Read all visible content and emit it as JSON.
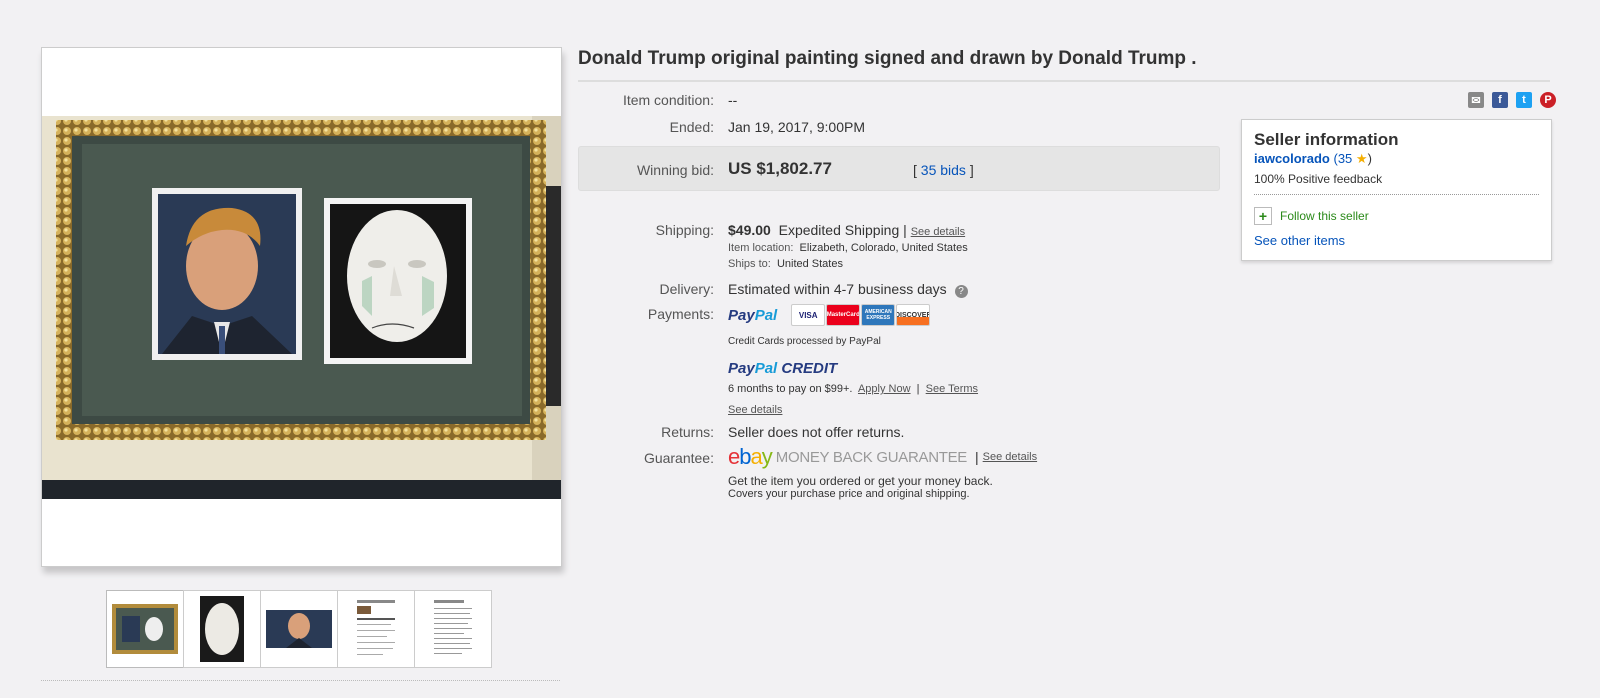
{
  "title": "Donald Trump original painting signed and drawn by Donald Trump .",
  "details": {
    "condition_label": "Item condition:",
    "condition_value": "--",
    "ended_label": "Ended:",
    "ended_value": "Jan 19, 2017, 9:00PM",
    "winning_bid_label": "Winning bid:",
    "winning_bid_value": "US $1,802.77",
    "bids_open": "[",
    "bids_link": "35 bids",
    "bids_close": "]",
    "shipping_label": "Shipping:",
    "shipping_price": "$49.00",
    "shipping_method": "Expedited Shipping",
    "shipping_separator": "|",
    "shipping_see_details": "See details",
    "item_location_label": "Item location:",
    "item_location_value": "Elizabeth, Colorado, United States",
    "ships_to_label": "Ships to:",
    "ships_to_value": "United States",
    "delivery_label": "Delivery:",
    "delivery_value": "Estimated within 4-7 business days",
    "delivery_help_icon": "?",
    "payments_label": "Payments:",
    "paypal_pay": "Pay",
    "paypal_pal": "Pal",
    "cards": [
      {
        "name": "VISA",
        "color": "#1a1f71"
      },
      {
        "name": "MasterCard",
        "color": "#eb001b"
      },
      {
        "name": "AMERICAN EXPRESS",
        "color": "#2e77bb"
      },
      {
        "name": "DISCOVER",
        "color": "#f76f20"
      }
    ],
    "credit_cards_note": "Credit Cards processed by PayPal",
    "paypal_credit_word": "CREDIT",
    "credit_offer": "6 months to pay on $99+.",
    "apply_now": "Apply Now",
    "credit_separator": "|",
    "see_terms": "See Terms",
    "credit_see_details": "See details",
    "returns_label": "Returns:",
    "returns_value": "Seller does not offer returns.",
    "guarantee_label": "Guarantee:",
    "ebay_letters": [
      "e",
      "b",
      "a",
      "y"
    ],
    "ebay_colors": [
      "#e53238",
      "#0064d2",
      "#f5af02",
      "#86b817"
    ],
    "money_back": "MONEY BACK GUARANTEE",
    "guarantee_separator": "|",
    "guarantee_see_details": "See details",
    "guarantee_line1": "Get the item you ordered or get your money back.",
    "guarantee_line2": "Covers your purchase price and original shipping."
  },
  "seller": {
    "heading": "Seller information",
    "username": "iawcolorado",
    "feedback_open": "(",
    "feedback_count": "35",
    "feedback_close": ")",
    "star_icon": "★",
    "positive": "100% Positive feedback",
    "follow_icon": "+",
    "follow_label": "Follow this seller",
    "other_items": "See other items"
  },
  "share": {
    "email_icon": "✉",
    "facebook_icon": "f",
    "twitter_icon": "t",
    "pinterest_icon": "P"
  }
}
